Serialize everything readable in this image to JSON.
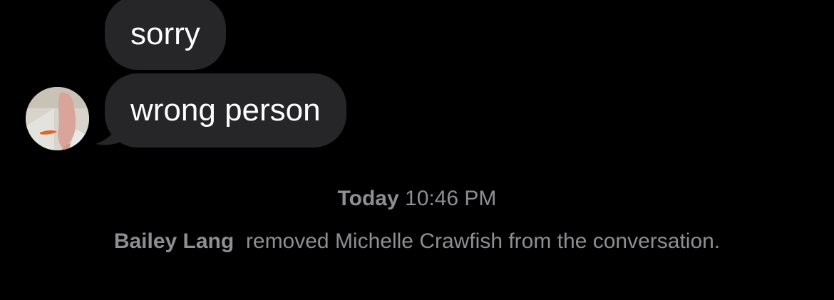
{
  "messages": [
    {
      "text": "sorry"
    },
    {
      "text": "wrong person"
    }
  ],
  "timestamp": {
    "day": "Today",
    "time": "10:46 PM"
  },
  "system_message": {
    "actor": "Bailey Lang",
    "action": "removed Michelle Crawfish from the conversation."
  },
  "colors": {
    "background": "#000000",
    "bubble": "#262628",
    "bubble_text": "#ffffff",
    "meta_text": "#8e8e93"
  },
  "icons": {
    "avatar": "sender-avatar-photo"
  }
}
